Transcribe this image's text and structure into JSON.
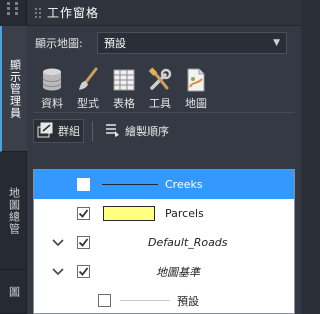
{
  "panel": {
    "title": "工作窗格"
  },
  "side_tabs": [
    {
      "label": "顯示管理員"
    },
    {
      "label": "地圖總管"
    },
    {
      "label": "圖"
    }
  ],
  "display_map": {
    "label": "顯示地圖:",
    "value": "預設"
  },
  "ribbon": [
    {
      "label": "資料",
      "icon": "database-icon"
    },
    {
      "label": "型式",
      "icon": "paintbrush-icon"
    },
    {
      "label": "表格",
      "icon": "table-icon"
    },
    {
      "label": "工具",
      "icon": "tools-icon"
    },
    {
      "label": "地圖",
      "icon": "map-icon"
    }
  ],
  "toolbar": {
    "group_label": "群組",
    "draw_order_label": "繪製順序"
  },
  "layers": [
    {
      "name": "Creeks",
      "checked": true,
      "selected": true,
      "symbol": "line"
    },
    {
      "name": "Parcels",
      "checked": true,
      "selected": false,
      "symbol": "fill",
      "fill_color": "#ffff80"
    },
    {
      "name": "Default_Roads",
      "checked": true,
      "expandable": true
    },
    {
      "name": "地圖基準",
      "checked": true,
      "expandable": true
    },
    {
      "name": "預設",
      "checked": false,
      "symbol": "line"
    }
  ],
  "colors": {
    "selection": "#3399ff",
    "parcel_fill": "#ffff80"
  }
}
